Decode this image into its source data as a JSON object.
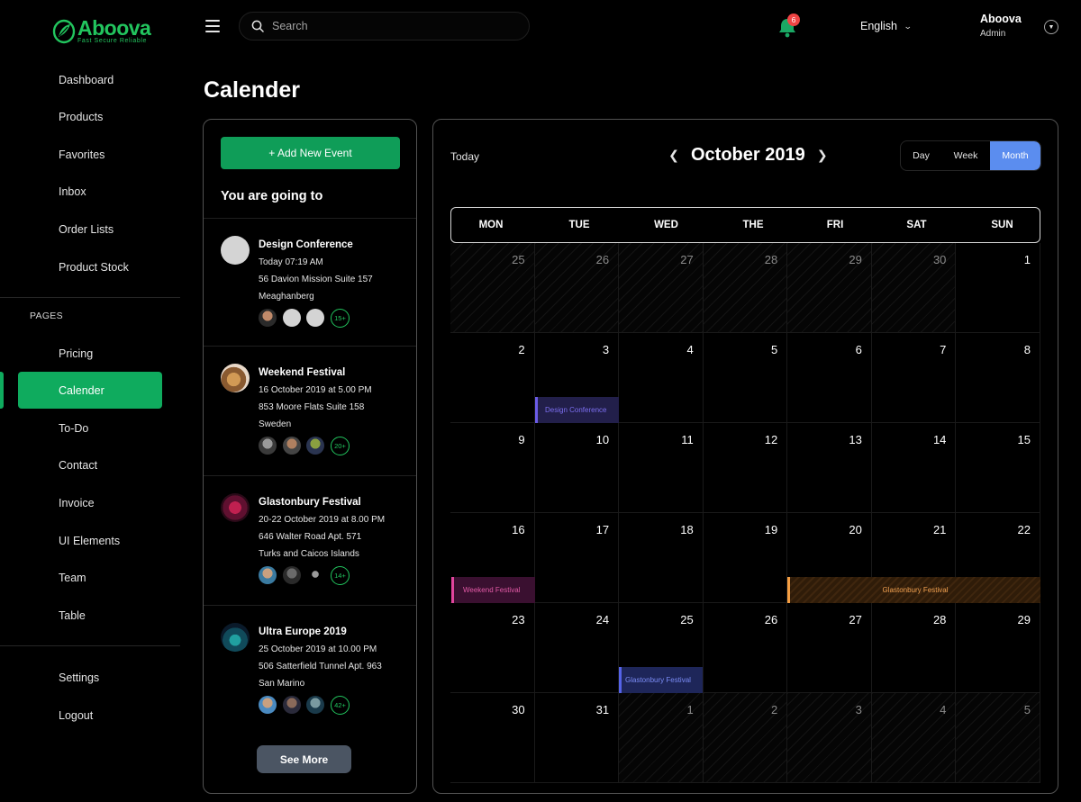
{
  "brand": {
    "name": "Aboova",
    "tagline": "Fast Secure Reliable"
  },
  "sidebar": {
    "items": [
      {
        "label": "Dashboard"
      },
      {
        "label": "Products"
      },
      {
        "label": "Favorites"
      },
      {
        "label": "Inbox"
      },
      {
        "label": "Order Lists"
      },
      {
        "label": "Product Stock"
      }
    ],
    "section_label": "PAGES",
    "pages": [
      {
        "label": "Pricing"
      },
      {
        "label": "Calender",
        "active": true
      },
      {
        "label": "To-Do"
      },
      {
        "label": "Contact"
      },
      {
        "label": "Invoice"
      },
      {
        "label": "UI Elements"
      },
      {
        "label": "Team"
      },
      {
        "label": "Table"
      }
    ],
    "bottom": [
      {
        "label": "Settings"
      },
      {
        "label": "Logout"
      }
    ]
  },
  "header": {
    "search_placeholder": "Search",
    "notifications_count": "6",
    "language": "English",
    "user": {
      "name": "Aboova",
      "role": "Admin"
    }
  },
  "page_title": "Calender",
  "events_panel": {
    "add_button": "+ Add New Event",
    "title": "You are going to",
    "events": [
      {
        "title": "Design Conference",
        "when": "Today 07:19 AM",
        "address": "56 Davion Mission Suite 157",
        "city": "Meaghanberg",
        "more": "15+"
      },
      {
        "title": "Weekend Festival",
        "when": "16 October 2019 at 5.00 PM",
        "address": "853 Moore Flats Suite 158",
        "city": "Sweden",
        "more": "20+"
      },
      {
        "title": "Glastonbury Festival",
        "when": "20-22 October 2019 at 8.00 PM",
        "address": "646 Walter Road Apt. 571",
        "city": "Turks and Caicos Islands",
        "more": "14+"
      },
      {
        "title": "Ultra Europe 2019",
        "when": "25 October 2019 at 10.00 PM",
        "address": "506 Satterfield Tunnel Apt. 963",
        "city": "San Marino",
        "more": "42+"
      }
    ],
    "see_more": "See More"
  },
  "calendar": {
    "today_label": "Today",
    "month_title": "October 2019",
    "views": [
      "Day",
      "Week",
      "Month"
    ],
    "active_view": "Month",
    "weekdays": [
      "MON",
      "TUE",
      "WED",
      "THE",
      "FRI",
      "SAT",
      "SUN"
    ],
    "weeks": [
      [
        "25",
        "26",
        "27",
        "28",
        "29",
        "30",
        "1"
      ],
      [
        "2",
        "3",
        "4",
        "5",
        "6",
        "7",
        "8"
      ],
      [
        "9",
        "10",
        "11",
        "12",
        "13",
        "14",
        "15"
      ],
      [
        "16",
        "17",
        "18",
        "19",
        "20",
        "21",
        "22"
      ],
      [
        "23",
        "24",
        "25",
        "26",
        "27",
        "28",
        "29"
      ],
      [
        "30",
        "31",
        "1",
        "2",
        "3",
        "4",
        "5"
      ]
    ],
    "outside_month": [
      [
        true,
        true,
        true,
        true,
        true,
        true,
        false
      ],
      [
        false,
        false,
        false,
        false,
        false,
        false,
        false
      ],
      [
        false,
        false,
        false,
        false,
        false,
        false,
        false
      ],
      [
        false,
        false,
        false,
        false,
        false,
        false,
        false
      ],
      [
        false,
        false,
        false,
        false,
        false,
        false,
        false
      ],
      [
        false,
        false,
        true,
        true,
        true,
        true,
        true
      ]
    ],
    "bars": [
      {
        "label": "Design Conference"
      },
      {
        "label": "Weekend Festival"
      },
      {
        "label": "Glastonbury Festival"
      },
      {
        "label": "Glastonbury Festival"
      }
    ]
  },
  "colors": {
    "accent_green": "#0fab5e",
    "month_button": "#5b8def",
    "notification_badge": "#ef4444"
  }
}
